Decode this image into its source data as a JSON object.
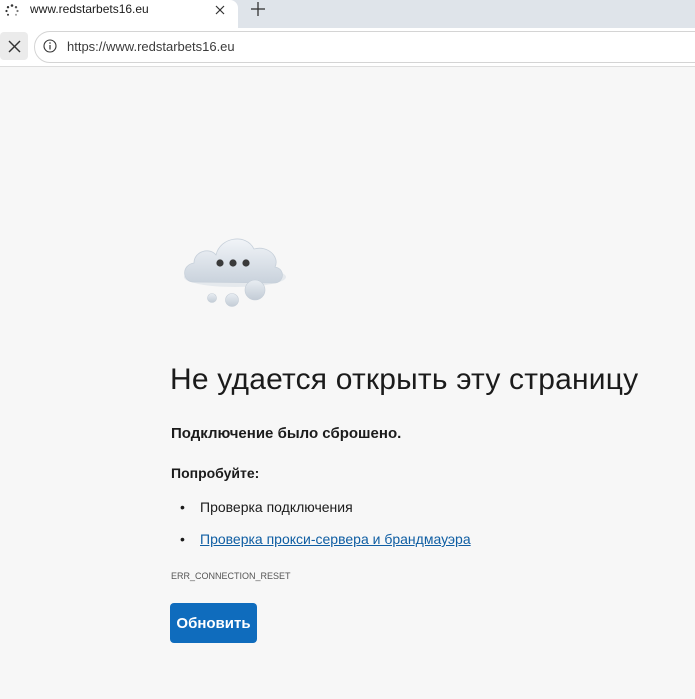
{
  "browser": {
    "tab": {
      "title": "www.redstarbets16.eu"
    },
    "address_bar": {
      "url": "https://www.redstarbets16.eu"
    }
  },
  "error_page": {
    "heading": "Не удается открыть эту страницу",
    "subtitle": "Подключение было сброшено.",
    "try_label": "Попробуйте:",
    "suggestions": [
      "Проверка подключения",
      "Проверка прокси-сервера и брандмауэра"
    ],
    "error_code": "ERR_CONNECTION_RESET",
    "reload_label": "Обновить"
  },
  "icons": {
    "tab_spinner": "loading-spinner-icon",
    "tab_close": "close-icon",
    "new_tab": "plus-icon",
    "stop": "close-icon",
    "site_info": "info-icon",
    "illustration": "cloud-icon"
  },
  "colors": {
    "page_background": "#f7f7f7",
    "link": "#0f5ea3",
    "primary_button": "#0f6cbd"
  }
}
